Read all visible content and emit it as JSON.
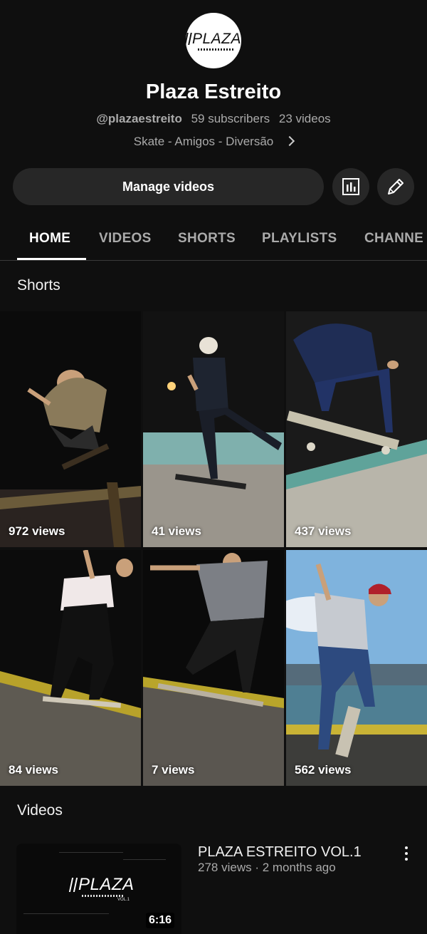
{
  "channel": {
    "name": "Plaza Estreito",
    "handle": "@plazaestreito",
    "subscribers": "59 subscribers",
    "video_count": "23 videos",
    "description": "Skate - Amigos - Diversão",
    "avatar_logo_text": "PLAZA"
  },
  "actions": {
    "manage_videos": "Manage videos",
    "analytics_icon": "analytics-icon",
    "edit_icon": "pencil-icon"
  },
  "tabs": [
    {
      "label": "HOME",
      "active": true
    },
    {
      "label": "VIDEOS",
      "active": false
    },
    {
      "label": "SHORTS",
      "active": false
    },
    {
      "label": "PLAYLISTS",
      "active": false
    },
    {
      "label": "CHANNE",
      "active": false
    }
  ],
  "shorts_section": {
    "title": "Shorts",
    "items": [
      {
        "views": "972 views"
      },
      {
        "views": "41 views"
      },
      {
        "views": "437 views"
      },
      {
        "views": "84 views"
      },
      {
        "views": "7 views"
      },
      {
        "views": "562 views"
      }
    ]
  },
  "videos_section": {
    "title": "Videos",
    "items": [
      {
        "title": "PLAZA ESTREITO VOL.1",
        "meta": "278 views · 2 months ago",
        "duration": "6:16",
        "thumb_logo": "PLAZA",
        "thumb_sub": "VOL.1"
      }
    ]
  },
  "colors": {
    "background": "#0f0f0f",
    "button": "#272727",
    "text_primary": "#f1f1f1",
    "text_secondary": "#aaaaaa"
  }
}
